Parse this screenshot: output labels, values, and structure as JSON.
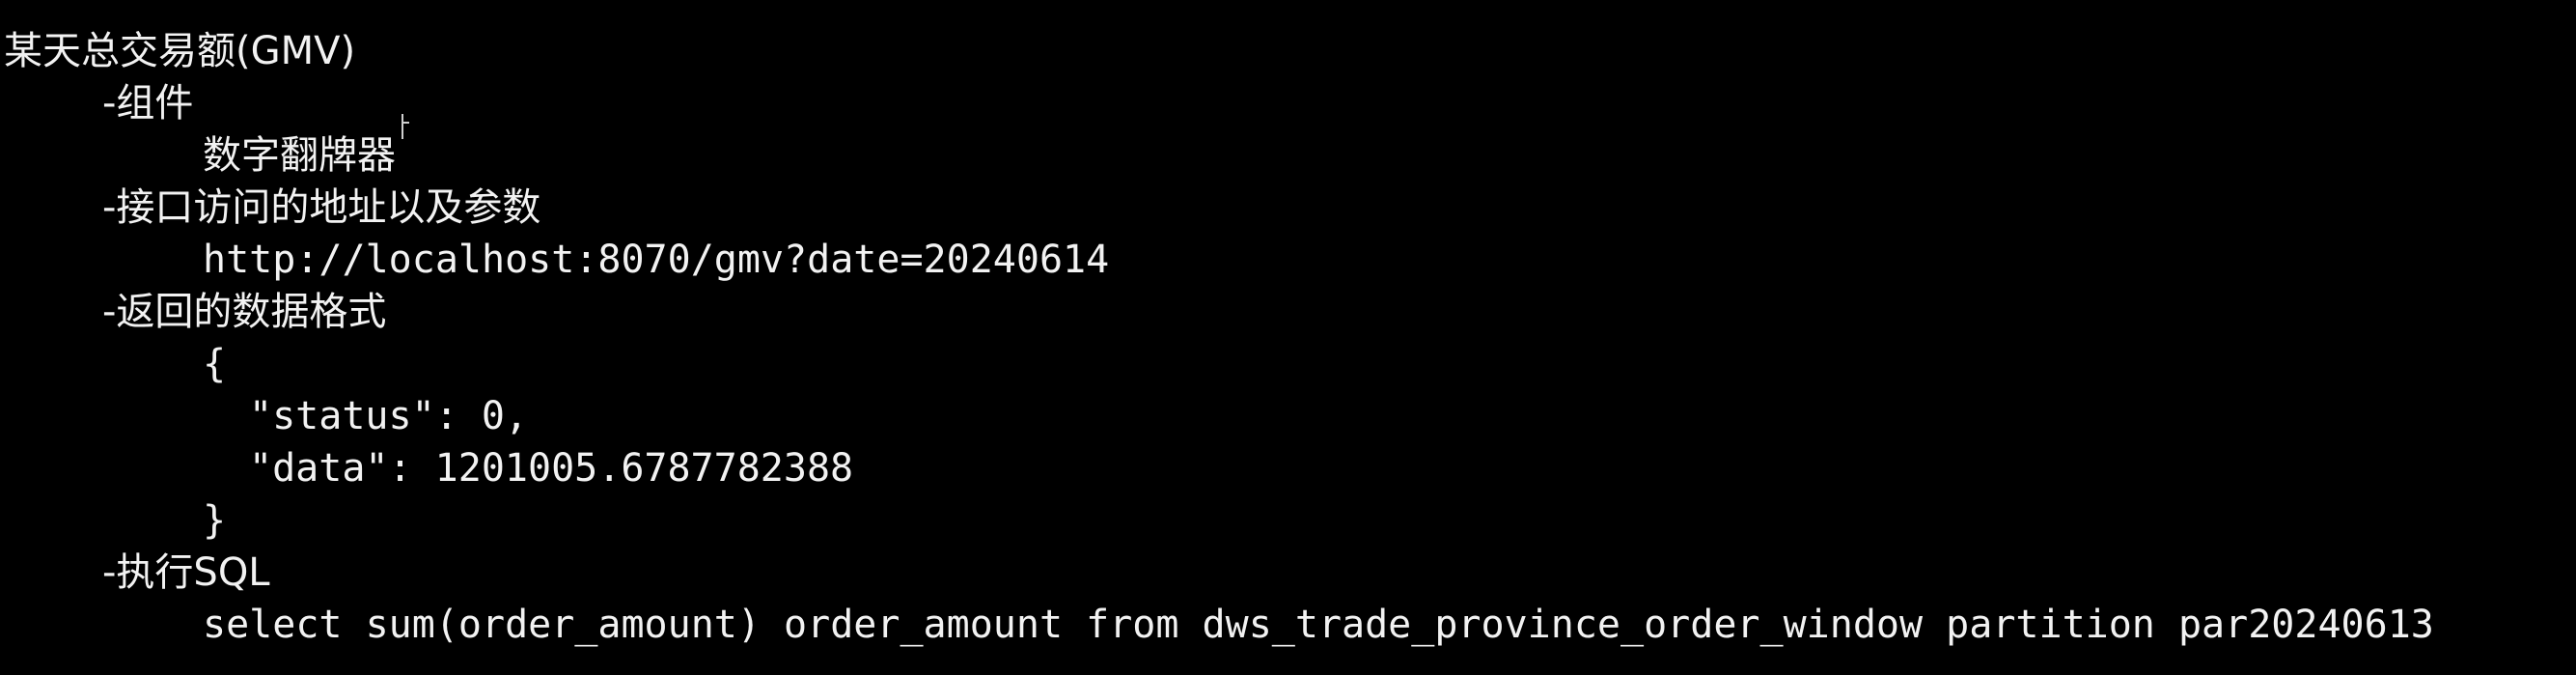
{
  "document": {
    "title": "某天总交易额(GMV)",
    "sections": [
      {
        "heading": "-组件",
        "lines": [
          "数字翻牌器"
        ]
      },
      {
        "heading": "-接口访问的地址以及参数",
        "lines": [
          "http://localhost:8070/gmv?date=20240614"
        ]
      },
      {
        "heading": "-返回的数据格式",
        "json": {
          "open": "{",
          "status_line": "\"status\": 0,",
          "data_line": "\"data\": 1201005.6787782388",
          "close": "}"
        }
      },
      {
        "heading": "-执行SQL",
        "lines": [
          "select sum(order_amount) order_amount from dws_trade_province_order_window partition par20240613"
        ]
      }
    ]
  },
  "colors": {
    "background": "#000000",
    "text": "#f2f2f2"
  }
}
